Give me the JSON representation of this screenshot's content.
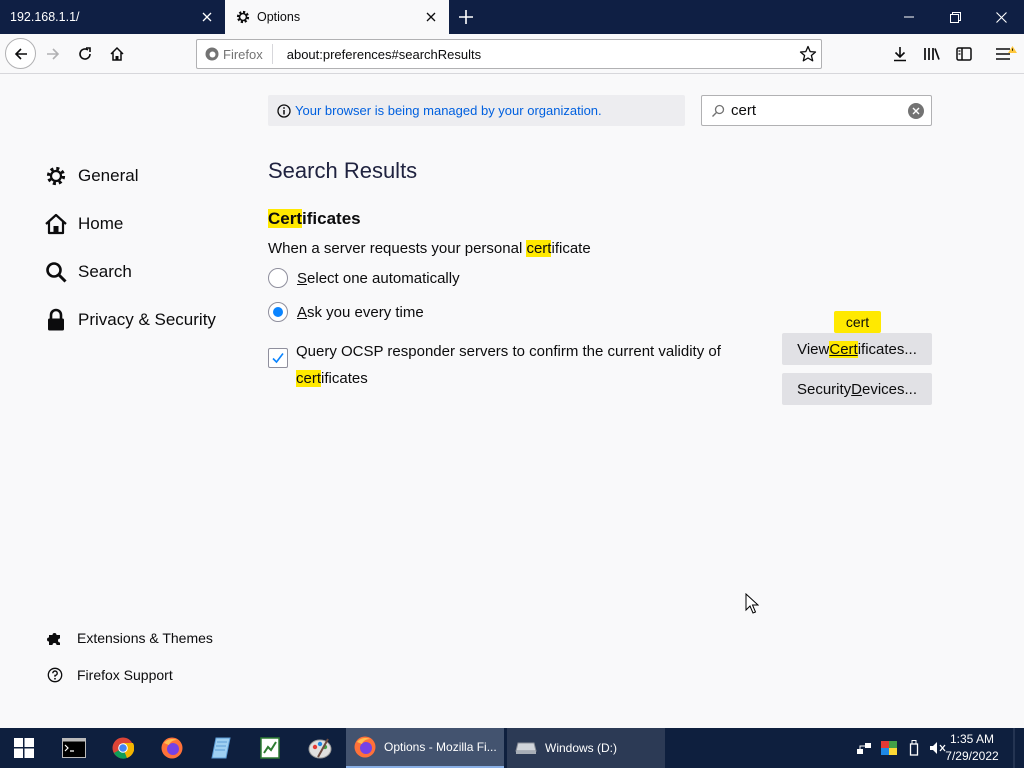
{
  "tabs": [
    {
      "title": "192.168.1.1/",
      "active": false
    },
    {
      "title": "Options",
      "active": true
    }
  ],
  "urlbar": {
    "identity": "Firefox",
    "url": "about:preferences#searchResults"
  },
  "notice": "Your browser is being managed by your organization.",
  "search": {
    "value": "cert"
  },
  "categories": [
    {
      "label": "General",
      "icon": "gear-icon"
    },
    {
      "label": "Home",
      "icon": "home-icon"
    },
    {
      "label": "Search",
      "icon": "search-icon"
    },
    {
      "label": "Privacy & Security",
      "icon": "lock-icon"
    }
  ],
  "footer": {
    "extensions": "Extensions & Themes",
    "support": "Firefox Support"
  },
  "results": {
    "heading": "Search Results",
    "section_pre": "Cert",
    "section_post": "ificates",
    "desc_pre": "When a server requests your personal ",
    "desc_hl": "cert",
    "desc_post": "ificate",
    "radio1_u": "S",
    "radio1_rest": "elect one automatically",
    "radio1_selected": false,
    "radio2_u": "A",
    "radio2_rest": "sk you every time",
    "radio2_selected": true,
    "ocsp_line1": "Query OCSP responder servers to confirm the current validity of",
    "ocsp_hl": "cert",
    "ocsp_post": "ificates",
    "ocsp_checked": true,
    "view_pre": "View ",
    "view_hl": "Cert",
    "view_post": "ificates...",
    "security_pre": "Security ",
    "security_u": "D",
    "security_post": "evices...",
    "tooltip": "cert"
  },
  "taskbar": {
    "firefox_task": "Options - Mozilla Fi...",
    "drive_task": "Windows (D:)",
    "time": "1:35 AM",
    "date": "7/29/2022"
  },
  "colors": {
    "tabstrip": "#0f1f44",
    "highlight": "#ffe900",
    "accent": "#0a84ff",
    "taskbar": "#0e1f3e"
  }
}
